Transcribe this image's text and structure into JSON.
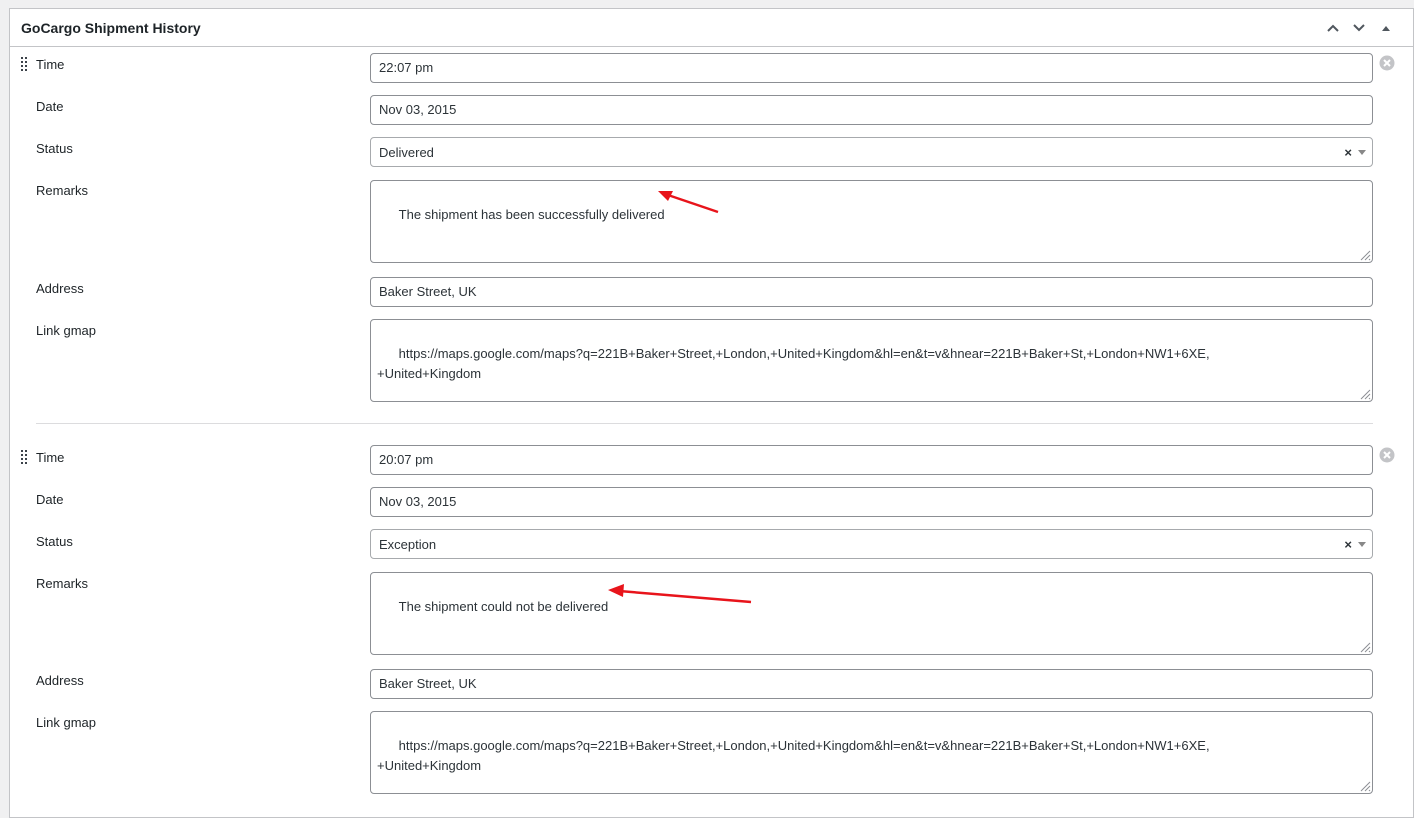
{
  "panel": {
    "title": "GoCargo Shipment History",
    "controls": [
      "chevron-up-icon",
      "chevron-down-icon",
      "triangle-up-icon"
    ]
  },
  "labels": {
    "time": "Time",
    "date": "Date",
    "status": "Status",
    "remarks": "Remarks",
    "address": "Address",
    "link": "Link gmap"
  },
  "entries": [
    {
      "time": "22:07 pm",
      "date": "Nov 03, 2015",
      "status": "Delivered",
      "status_clear": "×",
      "remarks": "The shipment has been successfully delivered",
      "address": "Baker Street, UK",
      "link": "https://maps.google.com/maps?q=221B+Baker+Street,+London,+United+Kingdom&hl=en&t=v&hnear=221B+Baker+St,+London+NW1+6XE,\n+United+Kingdom"
    },
    {
      "time": "20:07 pm",
      "date": "Nov 03, 2015",
      "status": "Exception",
      "status_clear": "×",
      "remarks": "The shipment could not be delivered",
      "address": "Baker Street, UK",
      "link": "https://maps.google.com/maps?q=221B+Baker+Street,+London,+United+Kingdom&hl=en&t=v&hnear=221B+Baker+St,+London+NW1+6XE,\n+United+Kingdom"
    }
  ],
  "colors": {
    "annotation_arrow": "#e8141b",
    "border": "#8c8f94",
    "text": "#1d2327"
  }
}
